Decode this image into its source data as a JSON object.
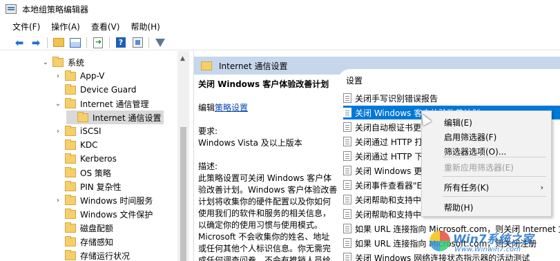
{
  "window": {
    "title": "本地组策略编辑器"
  },
  "menu": [
    "文件(F)",
    "操作(A)",
    "查看(V)",
    "帮助(H)"
  ],
  "tree": {
    "items": [
      {
        "label": "系统",
        "chevron": "⌄"
      },
      {
        "label": "App-V",
        "chevron": "›"
      },
      {
        "label": "Device Guard",
        "chevron": ""
      },
      {
        "label": "Internet 通信管理",
        "chevron": "⌄"
      },
      {
        "label": "Internet 通信设置",
        "chevron": "",
        "selected": true
      },
      {
        "label": "iSCSI",
        "chevron": "›"
      },
      {
        "label": "KDC",
        "chevron": ""
      },
      {
        "label": "Kerberos",
        "chevron": ""
      },
      {
        "label": "OS 策略",
        "chevron": ""
      },
      {
        "label": "PIN 复杂性",
        "chevron": ""
      },
      {
        "label": "Windows 时间服务",
        "chevron": "›"
      },
      {
        "label": "Windows 文件保护",
        "chevron": ""
      },
      {
        "label": "磁盘配额",
        "chevron": ""
      },
      {
        "label": "存储感知",
        "chevron": ""
      },
      {
        "label": "存储运行状况",
        "chevron": ""
      }
    ]
  },
  "right": {
    "header": "Internet 通信设置",
    "description": {
      "title": "关闭 Windows 客户体验改善计划",
      "edit_prefix": "编辑",
      "edit_link": "策略设置",
      "req_label": "要求:",
      "req_value": "Windows Vista 及以上版本",
      "desc_label": "描述:",
      "desc_lines": [
        "此策略设置可关闭 Windows 客户体",
        "验改善计划。Windows 客户体验改善",
        "计划将收集你的硬件配置以及你如何",
        "使用我们的软件和服务的相关信息，",
        "以确定你的使用习惯与使用模式。",
        "Microsoft 不会收集你的姓名、地址",
        "或任何其他个人标识信息。你无需完",
        "成任何调查问卷，不会有推销人员给"
      ]
    },
    "settings_header": "设置",
    "settings": [
      {
        "label": "关闭手写识别错误报告"
      },
      {
        "label": "关闭 Windows 客户体验改善计划",
        "selected": true
      },
      {
        "label": "关闭自动根证书更"
      },
      {
        "label": "关闭通过 HTTP 打"
      },
      {
        "label": "关闭通过 HTTP 下"
      },
      {
        "label": "关闭 Windows 更"
      },
      {
        "label": "关闭事件查看器\"E"
      },
      {
        "label": "关闭帮助和支持中"
      },
      {
        "label": "关闭帮助和支持中"
      },
      {
        "label": "如果 URL 连接指向 Microsoft.com，则关闭 Internet 文"
      },
      {
        "label": "如果 URL 连接指向 Microsoft.com，则关闭注册"
      },
      {
        "label": "关闭 Windows 网络连接状态指示器的活动测试"
      }
    ]
  },
  "context_menu": {
    "items": [
      {
        "label": "编辑(E)",
        "enabled": true
      },
      {
        "label": "启用筛选器(F)",
        "enabled": true
      },
      {
        "label": "筛选器选项(O)...",
        "enabled": true
      },
      {
        "label": "重新应用筛选器(E)",
        "enabled": false
      },
      {
        "label": "所有任务(K)",
        "enabled": true,
        "submenu": true
      },
      {
        "label": "帮助(H)",
        "enabled": true
      }
    ]
  },
  "watermark": {
    "brand": "Win7系统之家",
    "url": "Www.Winwin7.com"
  },
  "colors": {
    "selection": "#0078d7",
    "pane_header": "#c6d7ec",
    "tree_selected": "#d9d9d9"
  }
}
